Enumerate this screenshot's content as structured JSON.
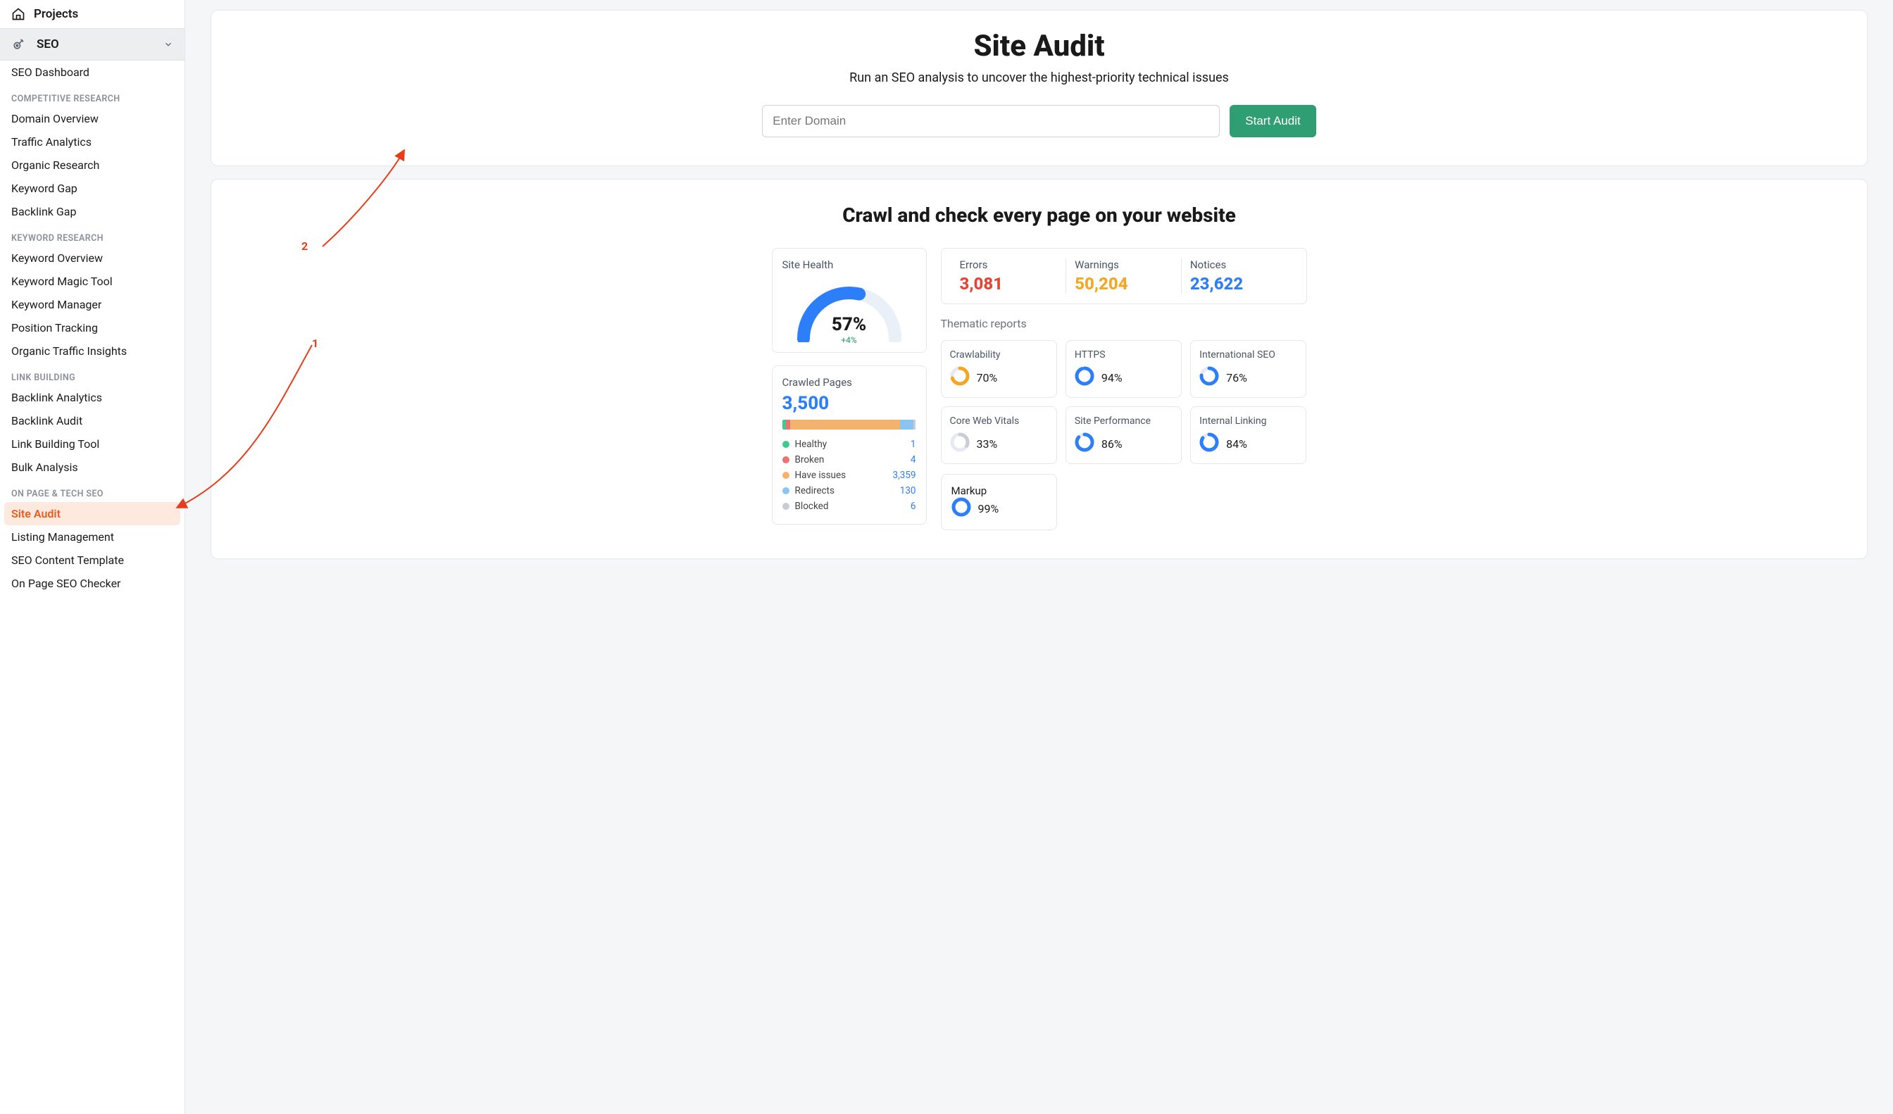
{
  "sidebar": {
    "projects": "Projects",
    "seo_label": "SEO",
    "item_dashboard": "SEO Dashboard",
    "groups": {
      "competitive": {
        "title": "COMPETITIVE RESEARCH",
        "items": [
          "Domain Overview",
          "Traffic Analytics",
          "Organic Research",
          "Keyword Gap",
          "Backlink Gap"
        ]
      },
      "keyword": {
        "title": "KEYWORD RESEARCH",
        "items": [
          "Keyword Overview",
          "Keyword Magic Tool",
          "Keyword Manager",
          "Position Tracking",
          "Organic Traffic Insights"
        ]
      },
      "link": {
        "title": "LINK BUILDING",
        "items": [
          "Backlink Analytics",
          "Backlink Audit",
          "Link Building Tool",
          "Bulk Analysis"
        ]
      },
      "onpage": {
        "title": "ON PAGE & TECH SEO",
        "items": [
          "Site Audit",
          "Listing Management",
          "SEO Content Template",
          "On Page SEO Checker"
        ]
      }
    },
    "active_item": "Site Audit"
  },
  "hero": {
    "title": "Site Audit",
    "subtitle": "Run an SEO analysis to uncover the highest-priority technical issues",
    "placeholder": "Enter Domain",
    "button": "Start Audit"
  },
  "crawl_section": {
    "title": "Crawl and check every page on your website",
    "health": {
      "label": "Site Health",
      "pct": "57%",
      "delta": "+4%",
      "gauge_pct_numeric": 57
    },
    "crawled": {
      "label": "Crawled Pages",
      "total": "3,500",
      "legend": [
        {
          "label": "Healthy",
          "value": "1",
          "color": "#3dcb8d"
        },
        {
          "label": "Broken",
          "value": "4",
          "color": "#ef7070"
        },
        {
          "label": "Have issues",
          "value": "3,359",
          "color": "#f5b26b"
        },
        {
          "label": "Redirects",
          "value": "130",
          "color": "#8ac4f3"
        },
        {
          "label": "Blocked",
          "value": "6",
          "color": "#c8cdd3"
        }
      ]
    },
    "trio": {
      "errors": {
        "label": "Errors",
        "value": "3,081"
      },
      "warnings": {
        "label": "Warnings",
        "value": "50,204"
      },
      "notices": {
        "label": "Notices",
        "value": "23,622"
      }
    },
    "thematic_label": "Thematic reports",
    "themes": [
      {
        "label": "Crawlability",
        "pct": "70%",
        "ratio": 0.7,
        "color": "#f5a623"
      },
      {
        "label": "HTTPS",
        "pct": "94%",
        "ratio": 0.94,
        "color": "#2d7ff9"
      },
      {
        "label": "International SEO",
        "pct": "76%",
        "ratio": 0.76,
        "color": "#2d7ff9"
      },
      {
        "label": "Core Web Vitals",
        "pct": "33%",
        "ratio": 0.33,
        "color": "#c8cdd3"
      },
      {
        "label": "Site Performance",
        "pct": "86%",
        "ratio": 0.86,
        "color": "#2d7ff9"
      },
      {
        "label": "Internal Linking",
        "pct": "84%",
        "ratio": 0.84,
        "color": "#2d7ff9"
      },
      {
        "label": "Markup",
        "pct": "99%",
        "ratio": 0.99,
        "color": "#2d7ff9"
      }
    ]
  },
  "annotations": {
    "label1": "1",
    "label2": "2"
  }
}
